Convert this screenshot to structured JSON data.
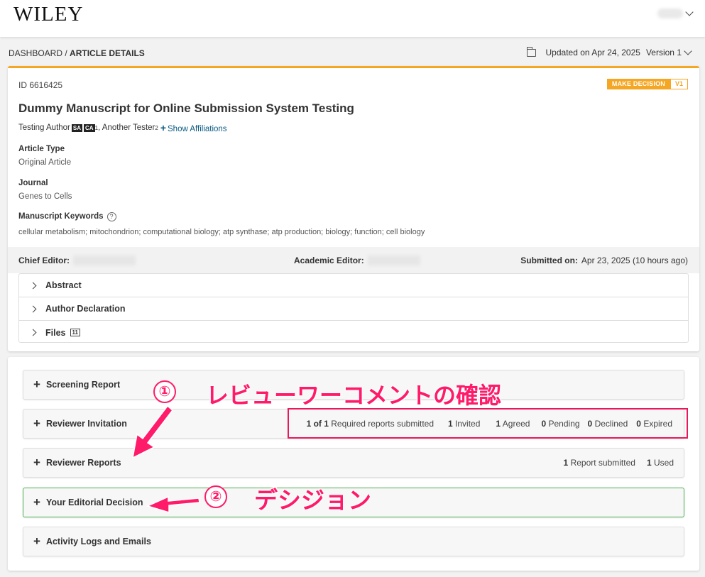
{
  "header": {
    "logo": "WILEY"
  },
  "breadcrumb": {
    "root": "DASHBOARD",
    "sep": " / ",
    "current": "ARTICLE DETAILS"
  },
  "meta": {
    "updated": "Updated on Apr 24, 2025",
    "version": "Version 1"
  },
  "manuscript": {
    "id": "ID 6616425",
    "status_badge": "MAKE DECISION",
    "version_badge": "V1",
    "title": "Dummy Manuscript for Online Submission System Testing",
    "author1": "Testing Author",
    "role1": "SA",
    "role2": "CA",
    "sup1": "1",
    "author2": ", Another Tester",
    "sup2": "2",
    "show_affiliations": "Show Affiliations",
    "article_type_label": "Article Type",
    "article_type": "Original Article",
    "journal_label": "Journal",
    "journal": "Genes to Cells",
    "keywords_label": "Manuscript Keywords",
    "keywords": "cellular metabolism; mitochondrion; computational biology; atp synthase; atp production; biology; function; cell biology"
  },
  "editors": {
    "chief_label": "Chief Editor:",
    "academic_label": "Academic Editor:",
    "submitted_label": "Submitted on:",
    "submitted_value": "Apr 23, 2025 (10 hours ago)"
  },
  "accordion": {
    "abstract": "Abstract",
    "declaration": "Author Declaration",
    "files": "Files",
    "files_count": "11"
  },
  "sections": {
    "screening": "Screening Report",
    "invitation": "Reviewer Invitation",
    "invitation_stats": [
      {
        "num": "1 of 1",
        "label": "Required reports submitted"
      },
      {
        "num": "1",
        "label": "Invited"
      },
      {
        "num": "1",
        "label": "Agreed"
      },
      {
        "num": "0",
        "label": "Pending"
      },
      {
        "num": "0",
        "label": "Declined"
      },
      {
        "num": "0",
        "label": "Expired"
      }
    ],
    "reports": "Reviewer Reports",
    "reports_stats": [
      {
        "num": "1",
        "label": "Report submitted"
      },
      {
        "num": "1",
        "label": "Used"
      }
    ],
    "decision": "Your Editorial Decision",
    "logs": "Activity Logs and Emails"
  },
  "annotations": {
    "circle1": "①",
    "text1": "レビューワーコメントの確認",
    "circle2": "②",
    "text2": "デシジョン",
    "color": "#ff1a6a"
  }
}
